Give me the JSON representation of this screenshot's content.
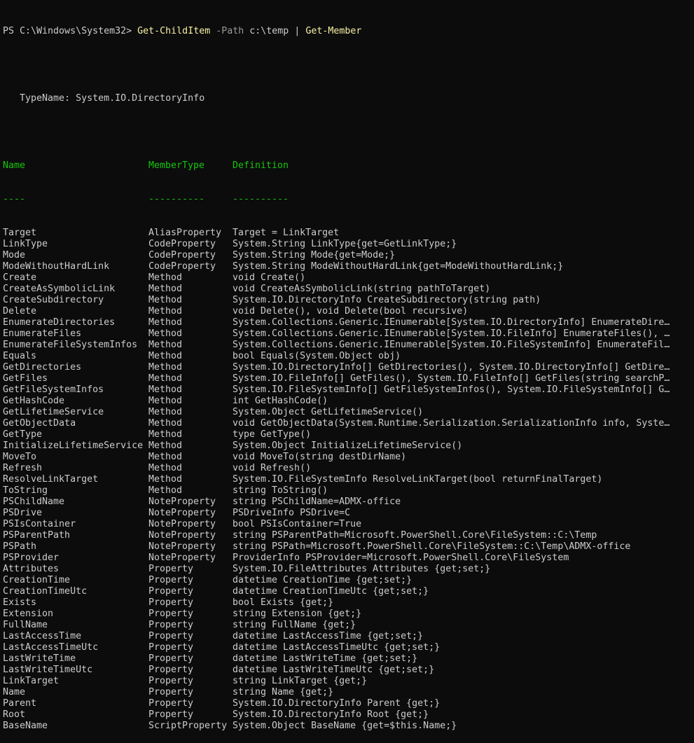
{
  "prompt": {
    "path": "PS C:\\Windows\\System32> ",
    "cmd1": "Get-ChildItem",
    "param": " -Path",
    "arg": " c:\\temp",
    "pipe": " | ",
    "cmd2": "Get-Member"
  },
  "typename": "   TypeName: System.IO.DirectoryInfo",
  "headers": {
    "name": "Name",
    "type": "MemberType",
    "def": "Definition",
    "u_name": "----",
    "u_type": "----------",
    "u_def": "----------"
  },
  "rows": [
    {
      "name": "Target",
      "type": "AliasProperty",
      "def": "Target = LinkTarget"
    },
    {
      "name": "LinkType",
      "type": "CodeProperty",
      "def": "System.String LinkType{get=GetLinkType;}"
    },
    {
      "name": "Mode",
      "type": "CodeProperty",
      "def": "System.String Mode{get=Mode;}"
    },
    {
      "name": "ModeWithoutHardLink",
      "type": "CodeProperty",
      "def": "System.String ModeWithoutHardLink{get=ModeWithoutHardLink;}"
    },
    {
      "name": "Create",
      "type": "Method",
      "def": "void Create()"
    },
    {
      "name": "CreateAsSymbolicLink",
      "type": "Method",
      "def": "void CreateAsSymbolicLink(string pathToTarget)"
    },
    {
      "name": "CreateSubdirectory",
      "type": "Method",
      "def": "System.IO.DirectoryInfo CreateSubdirectory(string path)"
    },
    {
      "name": "Delete",
      "type": "Method",
      "def": "void Delete(), void Delete(bool recursive)"
    },
    {
      "name": "EnumerateDirectories",
      "type": "Method",
      "def": "System.Collections.Generic.IEnumerable[System.IO.DirectoryInfo] EnumerateDire…"
    },
    {
      "name": "EnumerateFiles",
      "type": "Method",
      "def": "System.Collections.Generic.IEnumerable[System.IO.FileInfo] EnumerateFiles(), …"
    },
    {
      "name": "EnumerateFileSystemInfos",
      "type": "Method",
      "def": "System.Collections.Generic.IEnumerable[System.IO.FileSystemInfo] EnumerateFil…"
    },
    {
      "name": "Equals",
      "type": "Method",
      "def": "bool Equals(System.Object obj)"
    },
    {
      "name": "GetDirectories",
      "type": "Method",
      "def": "System.IO.DirectoryInfo[] GetDirectories(), System.IO.DirectoryInfo[] GetDire…"
    },
    {
      "name": "GetFiles",
      "type": "Method",
      "def": "System.IO.FileInfo[] GetFiles(), System.IO.FileInfo[] GetFiles(string searchP…"
    },
    {
      "name": "GetFileSystemInfos",
      "type": "Method",
      "def": "System.IO.FileSystemInfo[] GetFileSystemInfos(), System.IO.FileSystemInfo[] G…"
    },
    {
      "name": "GetHashCode",
      "type": "Method",
      "def": "int GetHashCode()"
    },
    {
      "name": "GetLifetimeService",
      "type": "Method",
      "def": "System.Object GetLifetimeService()"
    },
    {
      "name": "GetObjectData",
      "type": "Method",
      "def": "void GetObjectData(System.Runtime.Serialization.SerializationInfo info, Syste…"
    },
    {
      "name": "GetType",
      "type": "Method",
      "def": "type GetType()"
    },
    {
      "name": "InitializeLifetimeService",
      "type": "Method",
      "def": "System.Object InitializeLifetimeService()"
    },
    {
      "name": "MoveTo",
      "type": "Method",
      "def": "void MoveTo(string destDirName)"
    },
    {
      "name": "Refresh",
      "type": "Method",
      "def": "void Refresh()"
    },
    {
      "name": "ResolveLinkTarget",
      "type": "Method",
      "def": "System.IO.FileSystemInfo ResolveLinkTarget(bool returnFinalTarget)"
    },
    {
      "name": "ToString",
      "type": "Method",
      "def": "string ToString()"
    },
    {
      "name": "PSChildName",
      "type": "NoteProperty",
      "def": "string PSChildName=ADMX-office"
    },
    {
      "name": "PSDrive",
      "type": "NoteProperty",
      "def": "PSDriveInfo PSDrive=C"
    },
    {
      "name": "PSIsContainer",
      "type": "NoteProperty",
      "def": "bool PSIsContainer=True"
    },
    {
      "name": "PSParentPath",
      "type": "NoteProperty",
      "def": "string PSParentPath=Microsoft.PowerShell.Core\\FileSystem::C:\\Temp"
    },
    {
      "name": "PSPath",
      "type": "NoteProperty",
      "def": "string PSPath=Microsoft.PowerShell.Core\\FileSystem::C:\\Temp\\ADMX-office"
    },
    {
      "name": "PSProvider",
      "type": "NoteProperty",
      "def": "ProviderInfo PSProvider=Microsoft.PowerShell.Core\\FileSystem"
    },
    {
      "name": "Attributes",
      "type": "Property",
      "def": "System.IO.FileAttributes Attributes {get;set;}"
    },
    {
      "name": "CreationTime",
      "type": "Property",
      "def": "datetime CreationTime {get;set;}"
    },
    {
      "name": "CreationTimeUtc",
      "type": "Property",
      "def": "datetime CreationTimeUtc {get;set;}"
    },
    {
      "name": "Exists",
      "type": "Property",
      "def": "bool Exists {get;}"
    },
    {
      "name": "Extension",
      "type": "Property",
      "def": "string Extension {get;}"
    },
    {
      "name": "FullName",
      "type": "Property",
      "def": "string FullName {get;}"
    },
    {
      "name": "LastAccessTime",
      "type": "Property",
      "def": "datetime LastAccessTime {get;set;}"
    },
    {
      "name": "LastAccessTimeUtc",
      "type": "Property",
      "def": "datetime LastAccessTimeUtc {get;set;}"
    },
    {
      "name": "LastWriteTime",
      "type": "Property",
      "def": "datetime LastWriteTime {get;set;}"
    },
    {
      "name": "LastWriteTimeUtc",
      "type": "Property",
      "def": "datetime LastWriteTimeUtc {get;set;}"
    },
    {
      "name": "LinkTarget",
      "type": "Property",
      "def": "string LinkTarget {get;}"
    },
    {
      "name": "Name",
      "type": "Property",
      "def": "string Name {get;}"
    },
    {
      "name": "Parent",
      "type": "Property",
      "def": "System.IO.DirectoryInfo Parent {get;}"
    },
    {
      "name": "Root",
      "type": "Property",
      "def": "System.IO.DirectoryInfo Root {get;}"
    },
    {
      "name": "BaseName",
      "type": "ScriptProperty",
      "def": "System.Object BaseName {get=$this.Name;}"
    }
  ],
  "colors": {
    "background": "#0c0c0c",
    "text": "#cccccc",
    "command": "#f9f1a5",
    "parameter": "#9a9a9a",
    "header": "#16c60c"
  }
}
